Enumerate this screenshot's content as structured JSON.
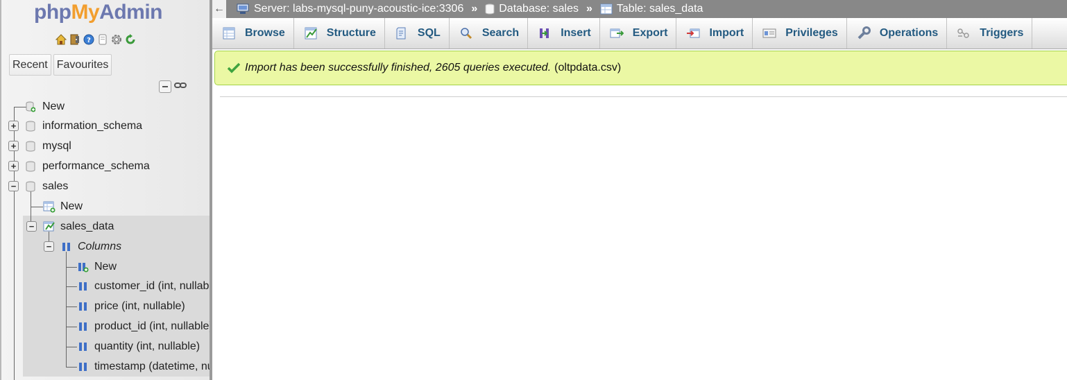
{
  "logo": {
    "part1": "php",
    "part2": "My",
    "part3": "Admin"
  },
  "logo_icons": [
    "home-icon",
    "exit-icon",
    "help-icon",
    "docs-icon",
    "settings-icon",
    "reload-icon"
  ],
  "nav": {
    "tabs": [
      {
        "label": "Recent"
      },
      {
        "label": "Favourites"
      }
    ],
    "tree": {
      "new_db": "New",
      "databases": [
        {
          "name": "information_schema",
          "expanded": false
        },
        {
          "name": "mysql",
          "expanded": false
        },
        {
          "name": "performance_schema",
          "expanded": false
        },
        {
          "name": "sales",
          "expanded": true
        }
      ],
      "sales_new_table": "New",
      "table": "sales_data",
      "columns_label": "Columns",
      "column_new": "New",
      "columns": [
        "customer_id (int, nullable)",
        "price (int, nullable)",
        "product_id (int, nullable)",
        "quantity (int, nullable)",
        "timestamp (datetime, nullable)"
      ]
    }
  },
  "breadcrumb": {
    "server": "Server: labs-mysql-puny-acoustic-ice:3306",
    "database": "Database: sales",
    "table": "Table: sales_data",
    "separator": "»"
  },
  "tabs": [
    {
      "label": "Browse",
      "icon": "browse-icon"
    },
    {
      "label": "Structure",
      "icon": "structure-icon"
    },
    {
      "label": "SQL",
      "icon": "sql-icon"
    },
    {
      "label": "Search",
      "icon": "search-icon"
    },
    {
      "label": "Insert",
      "icon": "insert-icon"
    },
    {
      "label": "Export",
      "icon": "export-icon"
    },
    {
      "label": "Import",
      "icon": "import-icon"
    },
    {
      "label": "Privileges",
      "icon": "privileges-icon"
    },
    {
      "label": "Operations",
      "icon": "operations-icon"
    },
    {
      "label": "Triggers",
      "icon": "triggers-icon"
    }
  ],
  "message": {
    "text": "Import has been successfully finished, 2605 queries executed.",
    "file": "(oltpdata.csv)"
  },
  "colors": {
    "tab_text": "#235a81",
    "success_bg": "#ebf8a4",
    "success_border": "#a2d246",
    "crumb_bg": "#888888"
  }
}
